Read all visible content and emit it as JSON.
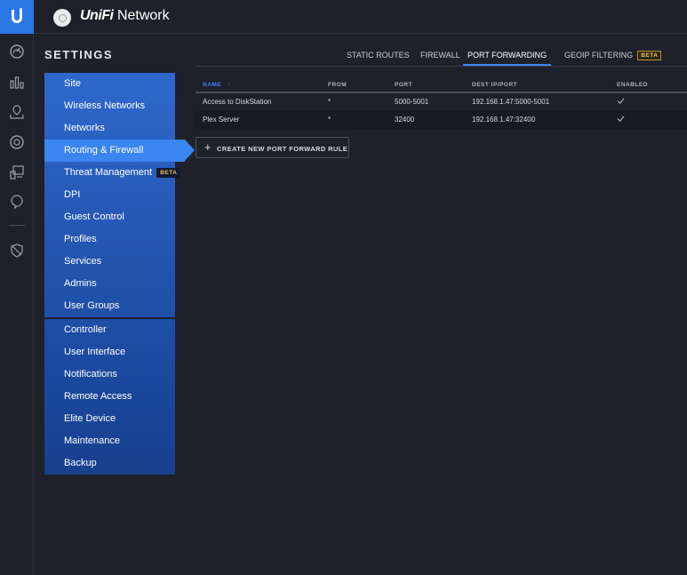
{
  "app": {
    "brand_part1": "UniFi",
    "brand_part2": "Network"
  },
  "rail": {
    "icons": [
      "dashboard-icon",
      "statistics-icon",
      "map-icon",
      "devices-icon",
      "clients-icon",
      "insights-icon",
      "shield-icon"
    ]
  },
  "settings": {
    "title": "SETTINGS"
  },
  "menu": {
    "group1": [
      {
        "label": "Site"
      },
      {
        "label": "Wireless Networks"
      },
      {
        "label": "Networks"
      },
      {
        "label": "Routing & Firewall",
        "active": true
      },
      {
        "label": "Threat Management",
        "badge": "BETA"
      },
      {
        "label": "DPI"
      },
      {
        "label": "Guest Control"
      },
      {
        "label": "Profiles"
      },
      {
        "label": "Services"
      },
      {
        "label": "Admins"
      },
      {
        "label": "User Groups"
      }
    ],
    "group2": [
      {
        "label": "Controller"
      },
      {
        "label": "User Interface"
      },
      {
        "label": "Notifications"
      },
      {
        "label": "Remote Access"
      },
      {
        "label": "Elite Device"
      },
      {
        "label": "Maintenance"
      },
      {
        "label": "Backup"
      }
    ]
  },
  "tabs": [
    {
      "label": "STATIC ROUTES"
    },
    {
      "label": "FIREWALL"
    },
    {
      "label": "PORT FORWARDING",
      "active": true
    },
    {
      "label": "GEOIP FILTERING",
      "badge": "BETA"
    }
  ],
  "table": {
    "headers": {
      "name": "NAME",
      "sort_arrow": "↑",
      "from": "FROM",
      "port": "PORT",
      "dest": "DEST IP/PORT",
      "enabled": "ENABLED"
    },
    "rows": [
      {
        "name": "Access to DiskStation",
        "from": "*",
        "port": "5000-5001",
        "dest": "192.168.1.47:5000-5001",
        "enabled": true
      },
      {
        "name": "Plex Server",
        "from": "*",
        "port": "32400",
        "dest": "192.168.1.47:32400",
        "enabled": true
      }
    ]
  },
  "actions": {
    "create_rule": "CREATE NEW PORT FORWARD RULE",
    "create_icon": "+"
  },
  "colors": {
    "accent": "#3a85f0",
    "logo_bg": "#2b78e4",
    "menu_top": "#2f68cc",
    "bg": "#1e212a",
    "beta": "#f0c14b"
  }
}
